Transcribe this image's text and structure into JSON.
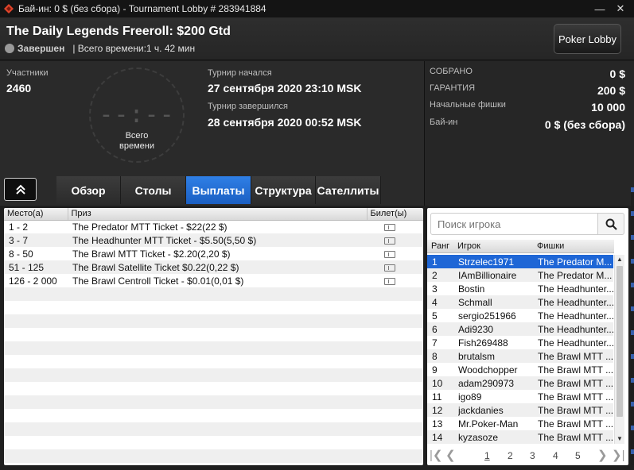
{
  "window": {
    "title": "Бай-ин: 0 $ (без сбора) - Tournament Lobby # 283941884",
    "minimize": "—",
    "close": "✕"
  },
  "header": {
    "tournament_name": "The Daily Legends Freeroll: $200 Gtd",
    "status": "Завершен",
    "total_time": "| Всего времени:1 ч. 42 мин",
    "lobby_button": "Poker Lobby"
  },
  "info": {
    "participants_label": "Участники",
    "participants_value": "2460",
    "clock_digits": "--:--",
    "clock_line1": "Всего",
    "clock_line2": "времени",
    "started_label": "Турнир начался",
    "started_value": "27 сентября 2020  23:10 MSK",
    "ended_label": "Турнир завершился",
    "ended_value": "28 сентября 2020  00:52 MSK"
  },
  "prize": {
    "rows": [
      {
        "label": "СОБРАНО",
        "value": "0 $"
      },
      {
        "label": "ГАРАНТИЯ",
        "value": "200 $"
      },
      {
        "label": "Начальные фишки",
        "value": "10 000"
      },
      {
        "label": "Бай-ин",
        "value": "0 $ (без сбора)"
      }
    ]
  },
  "tabs": [
    {
      "label": "Обзор",
      "active": false
    },
    {
      "label": "Столы",
      "active": false
    },
    {
      "label": "Выплаты",
      "active": true
    },
    {
      "label": "Структура",
      "active": false
    },
    {
      "label": "Сателлиты",
      "active": false
    }
  ],
  "payouts": {
    "headers": [
      "Место(а)",
      "Приз",
      "Билет(ы)"
    ],
    "rows": [
      {
        "place": "1 - 2",
        "prize": "The Predator MTT Ticket - $22(22 $)"
      },
      {
        "place": "3 - 7",
        "prize": "The Headhunter MTT Ticket - $5.50(5,50 $)"
      },
      {
        "place": "8 - 50",
        "prize": "The Brawl MTT Ticket - $2.20(2,20 $)"
      },
      {
        "place": "51 - 125",
        "prize": "The Brawl Satellite Ticket $0.22(0,22 $)"
      },
      {
        "place": "126 - 2 000",
        "prize": "The Brawl Centroll Ticket - $0.01(0,01 $)"
      }
    ]
  },
  "players": {
    "search_placeholder": "Поиск игрока",
    "headers": [
      "Ранг",
      "Игрок",
      "Фишки"
    ],
    "rows": [
      {
        "rank": "1",
        "player": "Strzelec1971",
        "chips": "The Predator M..."
      },
      {
        "rank": "2",
        "player": "IAmBillionaire",
        "chips": "The Predator M..."
      },
      {
        "rank": "3",
        "player": "Bostin",
        "chips": "The Headhunter..."
      },
      {
        "rank": "4",
        "player": "Schmall",
        "chips": "The Headhunter..."
      },
      {
        "rank": "5",
        "player": "sergio251966",
        "chips": "The Headhunter..."
      },
      {
        "rank": "6",
        "player": "Adi9230",
        "chips": "The Headhunter..."
      },
      {
        "rank": "7",
        "player": "Fish269488",
        "chips": "The Headhunter..."
      },
      {
        "rank": "8",
        "player": "brutalsm",
        "chips": "The Brawl MTT ..."
      },
      {
        "rank": "9",
        "player": "Woodchopper",
        "chips": "The Brawl MTT ..."
      },
      {
        "rank": "10",
        "player": "adam290973",
        "chips": "The Brawl MTT ..."
      },
      {
        "rank": "11",
        "player": "igo89",
        "chips": "The Brawl MTT ..."
      },
      {
        "rank": "12",
        "player": "jackdanies",
        "chips": "The Brawl MTT ..."
      },
      {
        "rank": "13",
        "player": "Mr.Poker-Man",
        "chips": "The Brawl MTT ..."
      },
      {
        "rank": "14",
        "player": "kyzasoze",
        "chips": "The Brawl MTT ..."
      }
    ],
    "pages": [
      "1",
      "2",
      "3",
      "4",
      "5"
    ],
    "current_page": "1"
  },
  "colors": {
    "accent": "#1e66d6",
    "tab_active": "#2f7fe6",
    "logo": "#e0442a"
  }
}
